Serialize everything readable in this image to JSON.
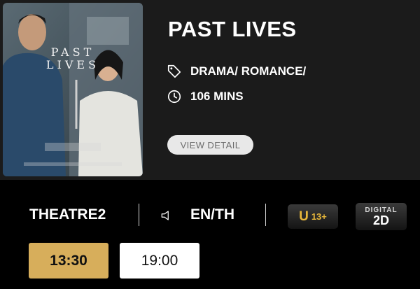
{
  "movie": {
    "title": "PAST LIVES",
    "genre": "DRAMA/ ROMANCE/",
    "duration": "106 MINS",
    "view_detail_label": "VIEW DETAIL",
    "poster": {
      "title_line1": "PAST",
      "title_line2": "LIVES"
    }
  },
  "session": {
    "theatre": "THEATRE2",
    "language": "EN/TH",
    "rating": {
      "letter": "U",
      "age": "13+"
    },
    "format": {
      "top": "DIGITAL",
      "bottom": "2D"
    }
  },
  "showtimes": [
    {
      "time": "13:30",
      "selected": true
    },
    {
      "time": "19:00",
      "selected": false
    }
  ],
  "colors": {
    "card_bg": "#1b1b1b",
    "page_bg": "#000000",
    "selected_showtime": "#d7ae5b",
    "rating_gold": "#e7b73b"
  },
  "icons": {
    "genre": "tag-icon",
    "duration": "clock-icon",
    "language": "speaker-icon"
  }
}
